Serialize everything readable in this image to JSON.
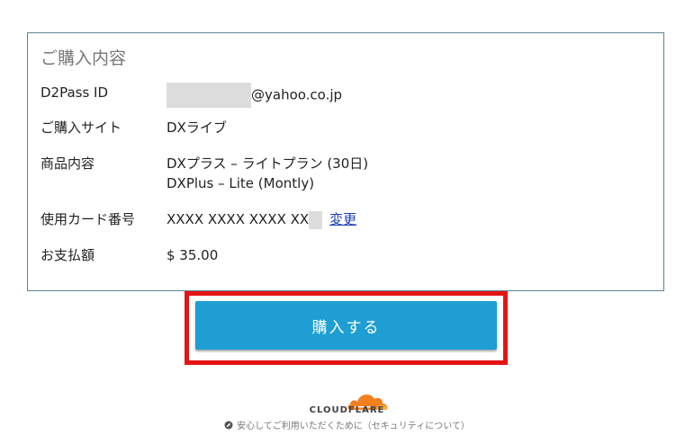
{
  "purchase": {
    "title": "ご購入内容",
    "rows": [
      {
        "label": "D2Pass ID",
        "value": "@yahoo.co.jp"
      },
      {
        "label": "ご購入サイト",
        "value": "DXライブ"
      },
      {
        "label": "商品内容",
        "value_line1": "DXプラス – ライトプラン (30日)",
        "value_line2": "DXPlus – Lite (Montly)"
      },
      {
        "label": "使用カード番号",
        "value": "XXXX XXXX XXXX XX",
        "link": "変更"
      },
      {
        "label": "お支払額",
        "value": "$ 35.00"
      }
    ]
  },
  "buy_button": {
    "label": "購入する",
    "color": "#1e9ed2",
    "highlight_color": "#e41414"
  },
  "cloudflare": {
    "brand": "CLOUDFLARE",
    "note": "安心してご利用いただくために（セキュリティについて）",
    "brand_color": "#f38020"
  }
}
